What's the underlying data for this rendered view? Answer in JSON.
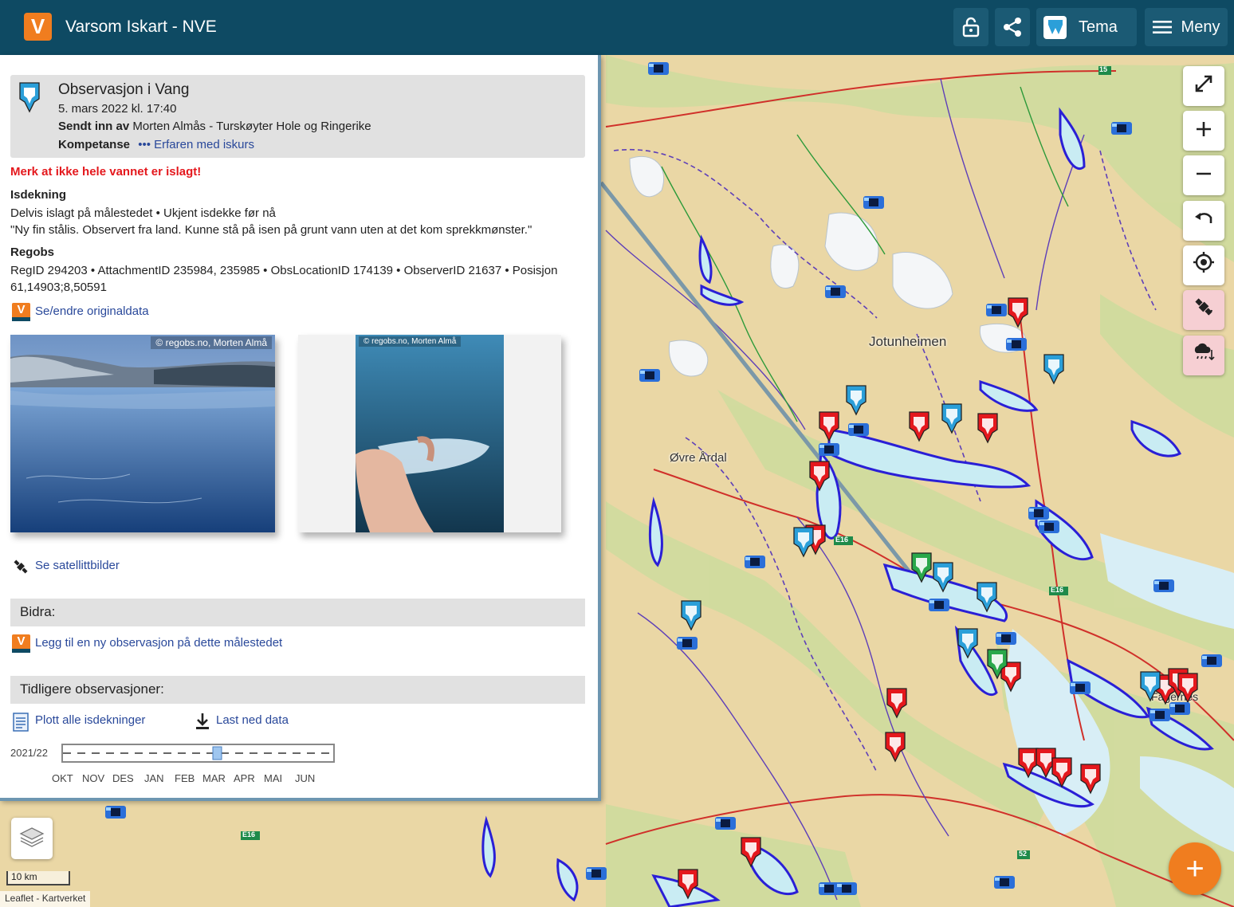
{
  "header": {
    "logo_letter": "V",
    "title": "Varsom Iskart - NVE",
    "theme_label": "Tema",
    "menu_label": "Meny",
    "icons": [
      "lock-icon",
      "share-icon",
      "tema-icon",
      "hamburger-icon"
    ]
  },
  "observation": {
    "title": "Observasjon i Vang",
    "date": "5. mars 2022  kl. 17:40",
    "sent_by_label": "Sendt inn av",
    "sent_by_value": "Morten Almås - Turskøyter Hole og Ringerike",
    "competence_label": "Kompetanse",
    "competence_dots": "•••",
    "competence_value": "Erfaren med iskurs",
    "warning": "Merk at ikke hele vannet er islagt!",
    "ice_heading": "Isdekning",
    "ice_line1": "Delvis islagt på målestedet • Ukjent isdekke før nå",
    "ice_line2": "\"Ny fin stålis. Observert fra land. Kunne stå på isen på grunt vann uten at det kom sprekkmønster.\"",
    "regobs_heading": "Regobs",
    "regobs_line": "RegID 294203 • AttachmentID 235984, 235985 • ObsLocationID 174139 • ObserverID 21637 • Posisjon 61,14903;8,50591",
    "edit_link": "Se/endre originaldata",
    "photo1_credit": "© regobs.no, Morten Almå",
    "photo2_credit": "© regobs.no, Morten Almå",
    "satellite_link": "Se satellittbilder"
  },
  "contribute": {
    "heading": "Bidra:",
    "add_link": "Legg til en ny observasjon på dette målestedet"
  },
  "history": {
    "heading": "Tidligere observasjoner:",
    "plot_link": "Plott alle isdekninger",
    "download_link": "Last ned data",
    "season": "2021/22",
    "months": [
      "OKT",
      "NOV",
      "DES",
      "JAN",
      "FEB",
      "MAR",
      "APR",
      "MAI",
      "JUN"
    ]
  },
  "map": {
    "labels": {
      "jotunheimen": "Jotunheimen",
      "ovre_ardal": "Øvre Årdal",
      "e16_a": "E16",
      "e16_b": "E16",
      "e16_c": "E16",
      "rv15": "15",
      "rv52": "52",
      "town": "Fagernes"
    },
    "scale_label": "10 km",
    "attribution": "Leaflet - Kartverket",
    "fab_label": "+",
    "controls": [
      "fullscreen-icon",
      "zoom-in-icon",
      "zoom-out-icon",
      "reset-view-icon",
      "locate-icon",
      "satellite-icon",
      "weather-icon"
    ],
    "colors": {
      "terrain": "#ead7a5",
      "forest": "#cfdc9e",
      "water_outline": "#2a1fd6",
      "water_fill": "#c9ecf3",
      "pin_red": "#e4181d",
      "pin_blue": "#2b9fd9",
      "pin_green": "#2aa84a"
    }
  }
}
